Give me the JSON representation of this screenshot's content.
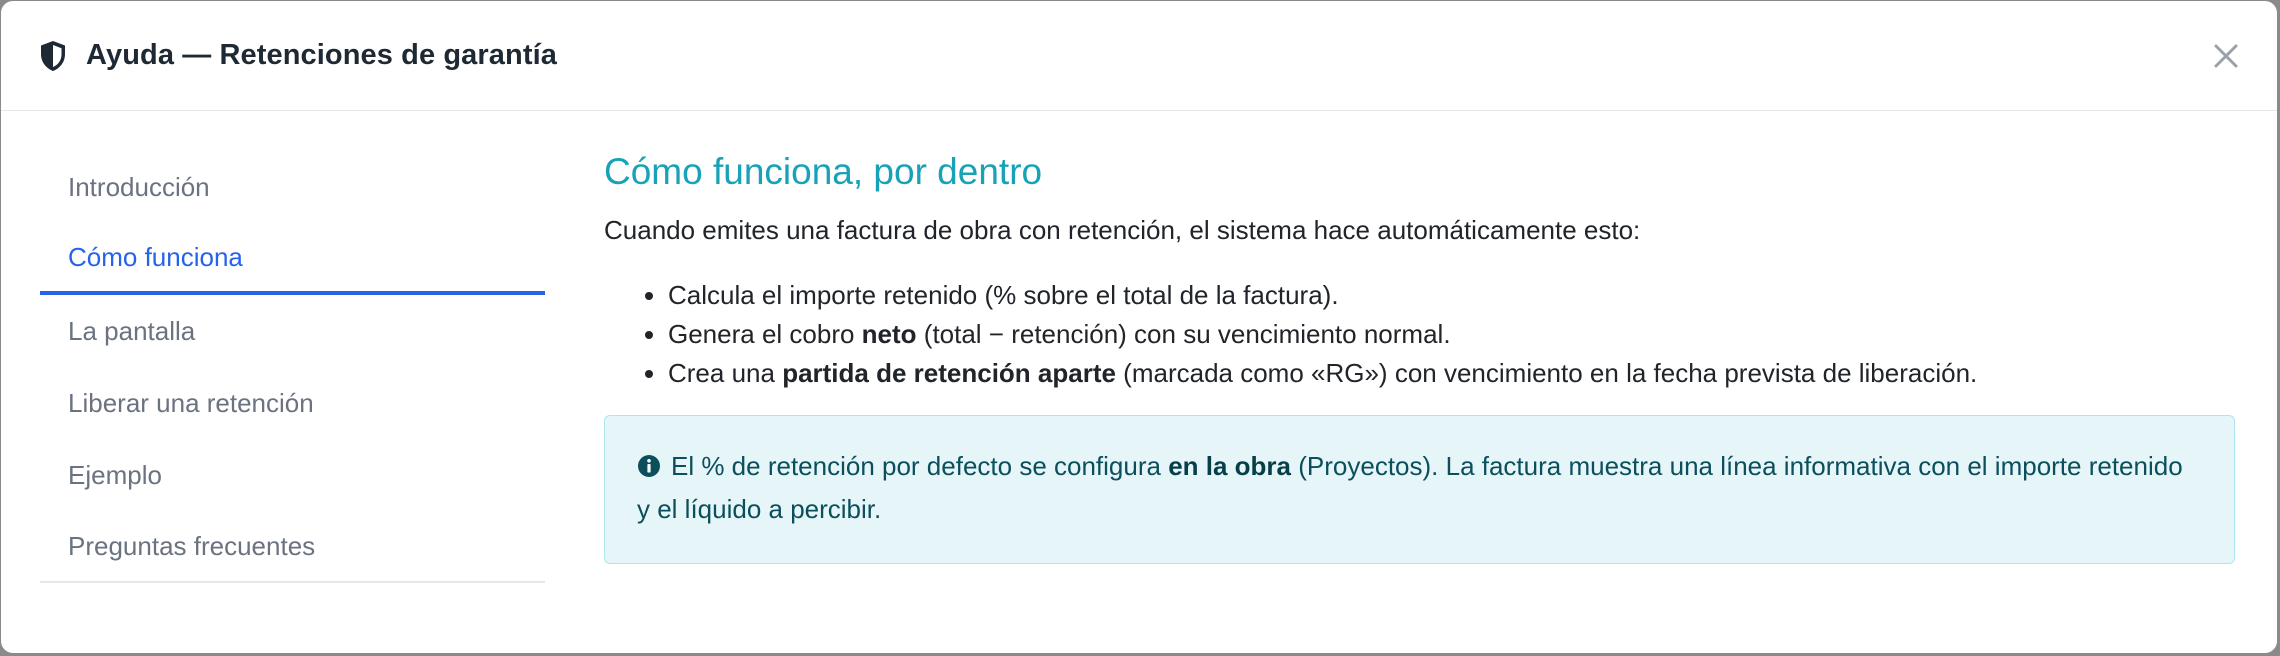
{
  "dialog": {
    "title": "Ayuda — Retenciones de garantía",
    "icon": "shield-icon",
    "close_icon": "close-icon"
  },
  "nav": {
    "items": [
      {
        "label": "Introducción",
        "active": false
      },
      {
        "label": "Cómo funciona",
        "active": true
      },
      {
        "label": "La pantalla",
        "active": false
      },
      {
        "label": "Liberar una retención",
        "active": false
      },
      {
        "label": "Ejemplo",
        "active": false
      },
      {
        "label": "Preguntas frecuentes",
        "active": false
      }
    ]
  },
  "content": {
    "title": "Cómo funciona, por dentro",
    "intro": "Cuando emites una factura de obra con retención, el sistema hace automáticamente esto:",
    "bullets": [
      {
        "text": "Calcula el importe retenido (% sobre el total de la factura)."
      },
      {
        "pre": "Genera el cobro ",
        "bold": "neto",
        "post": " (total − retención) con su vencimiento normal."
      },
      {
        "pre": "Crea una ",
        "bold": "partida de retención aparte",
        "post": " (marcada como «RG») con vencimiento en la fecha prevista de liberación."
      }
    ],
    "info": {
      "icon": "info-circle-icon",
      "pre": "El % de retención por defecto se configura ",
      "bold": "en la obra",
      "post": " (Proyectos). La factura muestra una línea informativa con el importe retenido y el líquido a percibir."
    }
  },
  "colors": {
    "accent_active": "#2563eb",
    "section_title": "#17a2b8",
    "info_bg": "#e6f6f8",
    "info_border": "#aee6ee"
  }
}
